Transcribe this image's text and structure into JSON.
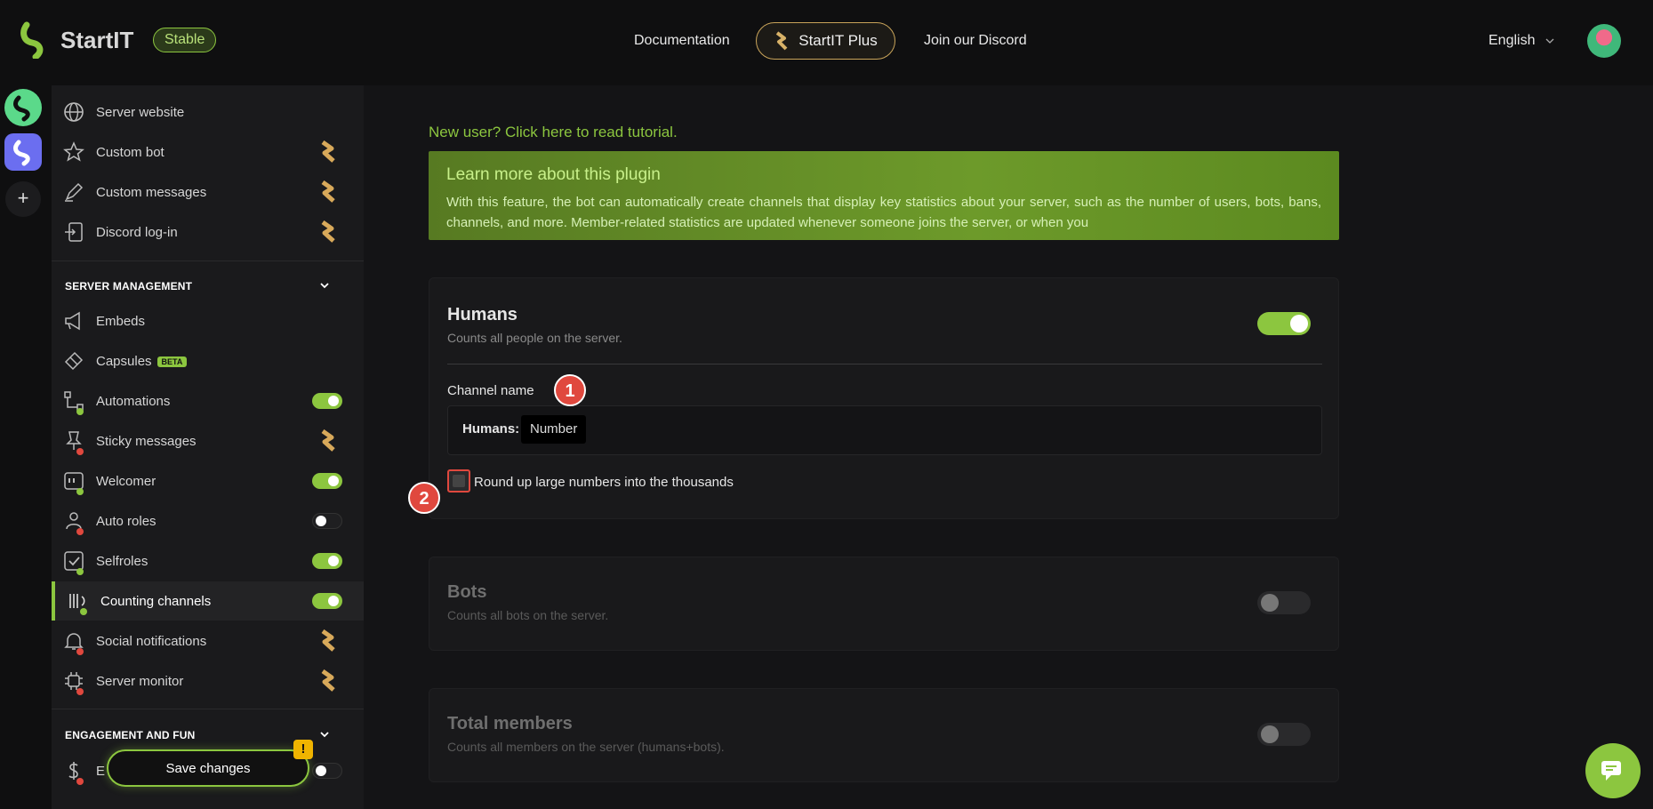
{
  "header": {
    "brand": "StartIT",
    "channel_badge": "Stable",
    "nav": {
      "documentation": "Documentation",
      "plus": "StartIT Plus",
      "discord": "Join our Discord"
    },
    "language": "English"
  },
  "rail": {
    "add_label": "+"
  },
  "sidebar": {
    "top_items": [
      {
        "label": "Server website"
      },
      {
        "label": "Custom bot"
      },
      {
        "label": "Custom messages"
      },
      {
        "label": "Discord log-in"
      }
    ],
    "sections": [
      {
        "title": "SERVER MANAGEMENT"
      },
      {
        "title": "ENGAGEMENT AND FUN"
      }
    ],
    "management_items": [
      {
        "label": "Embeds"
      },
      {
        "label": "Capsules",
        "badge": "BETA"
      },
      {
        "label": "Automations",
        "toggle": "on"
      },
      {
        "label": "Sticky messages"
      },
      {
        "label": "Welcomer",
        "toggle": "on"
      },
      {
        "label": "Auto roles",
        "toggle": "off"
      },
      {
        "label": "Selfroles",
        "toggle": "on"
      },
      {
        "label": "Counting channels",
        "toggle": "on",
        "active": true
      },
      {
        "label": "Social notifications"
      },
      {
        "label": "Server monitor"
      }
    ],
    "engagement_items": [
      {
        "label": "E",
        "toggle": "off"
      }
    ]
  },
  "save": {
    "label": "Save changes",
    "warning": "!"
  },
  "main": {
    "tutorial_link": "New user? Click here to read tutorial.",
    "learn": {
      "title": "Learn more about this plugin",
      "text": "With this feature, the bot can automatically create channels that display key statistics about your server, such as the number of users, bots, bans, channels, and more. Member-related statistics are updated whenever someone joins the server, or when you"
    },
    "cards": [
      {
        "title": "Humans",
        "subtitle": "Counts all people on the server.",
        "enabled": true,
        "channel_label": "Channel name",
        "channel_prefix": "Humans:",
        "channel_chip": "Number",
        "checkbox_label": "Round up large numbers into the thousands",
        "checked": false
      },
      {
        "title": "Bots",
        "subtitle": "Counts all bots on the server.",
        "enabled": false
      },
      {
        "title": "Total members",
        "subtitle": "Counts all members on the server (humans+bots).",
        "enabled": false
      }
    ],
    "annotations": [
      "1",
      "2"
    ]
  },
  "colors": {
    "accent": "#8cc63f",
    "plus_gold": "#c9a45a",
    "alert_red": "#e0483e",
    "warning_yellow": "#f0b400"
  }
}
